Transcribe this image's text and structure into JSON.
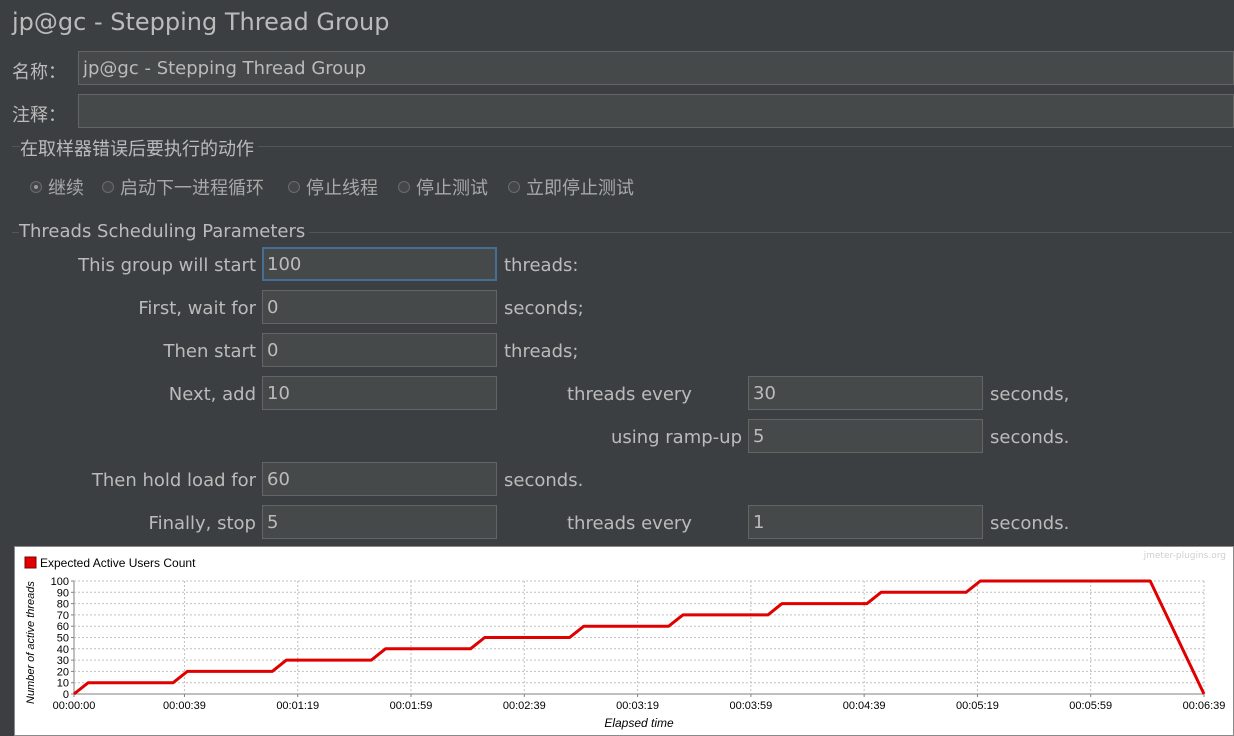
{
  "window": {
    "title": "jp@gc - Stepping Thread Group"
  },
  "name_field": {
    "label": "名称：",
    "value": "jp@gc - Stepping Thread Group"
  },
  "comment_field": {
    "label": "注释：",
    "value": ""
  },
  "error_action": {
    "title": "在取样器错误后要执行的动作",
    "options": [
      {
        "label": "继续",
        "selected": true
      },
      {
        "label": "启动下一进程循环",
        "selected": false
      },
      {
        "label": "停止线程",
        "selected": false
      },
      {
        "label": "停止测试",
        "selected": false
      },
      {
        "label": "立即停止测试",
        "selected": false
      }
    ]
  },
  "scheduling": {
    "title": "Threads Scheduling Parameters",
    "start_label": "This group will start",
    "start_value": "100",
    "start_unit": "threads:",
    "wait_label": "First, wait for",
    "wait_value": "0",
    "wait_unit": "seconds;",
    "then_start_label": "Then start",
    "then_start_value": "0",
    "then_start_unit": "threads;",
    "add_label": "Next, add",
    "add_value": "10",
    "add_every_label": "threads every",
    "add_every_value": "30",
    "add_every_unit": "seconds,",
    "rampup_label": "using ramp-up",
    "rampup_value": "5",
    "rampup_unit": "seconds.",
    "hold_label": "Then hold load for",
    "hold_value": "60",
    "hold_unit": "seconds.",
    "stop_label": "Finally, stop",
    "stop_value": "5",
    "stop_every_label": "threads every",
    "stop_every_value": "1",
    "stop_every_unit": "seconds."
  },
  "chart_data": {
    "type": "line",
    "legend": "Expected Active Users Count",
    "watermark": "jmeter-plugins.org",
    "xlabel": "Elapsed time",
    "ylabel": "Number of active threads",
    "xlim": [
      0,
      399
    ],
    "ylim": [
      0,
      100
    ],
    "x_ticks": [
      {
        "t": 0,
        "label": "00:00:00"
      },
      {
        "t": 39,
        "label": "00:00:39"
      },
      {
        "t": 79,
        "label": "00:01:19"
      },
      {
        "t": 119,
        "label": "00:01:59"
      },
      {
        "t": 159,
        "label": "00:02:39"
      },
      {
        "t": 199,
        "label": "00:03:19"
      },
      {
        "t": 239,
        "label": "00:03:59"
      },
      {
        "t": 279,
        "label": "00:04:39"
      },
      {
        "t": 319,
        "label": "00:05:19"
      },
      {
        "t": 359,
        "label": "00:05:59"
      },
      {
        "t": 399,
        "label": "00:06:39"
      }
    ],
    "y_ticks": [
      0,
      10,
      20,
      30,
      40,
      50,
      60,
      70,
      80,
      90,
      100
    ],
    "series": [
      {
        "color": "#e00000",
        "x": [
          0,
          5,
          35,
          40,
          70,
          75,
          105,
          110,
          140,
          145,
          175,
          180,
          210,
          215,
          245,
          250,
          280,
          285,
          315,
          320,
          380,
          399
        ],
        "y": [
          0,
          10,
          10,
          20,
          20,
          30,
          30,
          40,
          40,
          50,
          50,
          60,
          60,
          70,
          70,
          80,
          80,
          90,
          90,
          100,
          100,
          0
        ]
      }
    ]
  }
}
